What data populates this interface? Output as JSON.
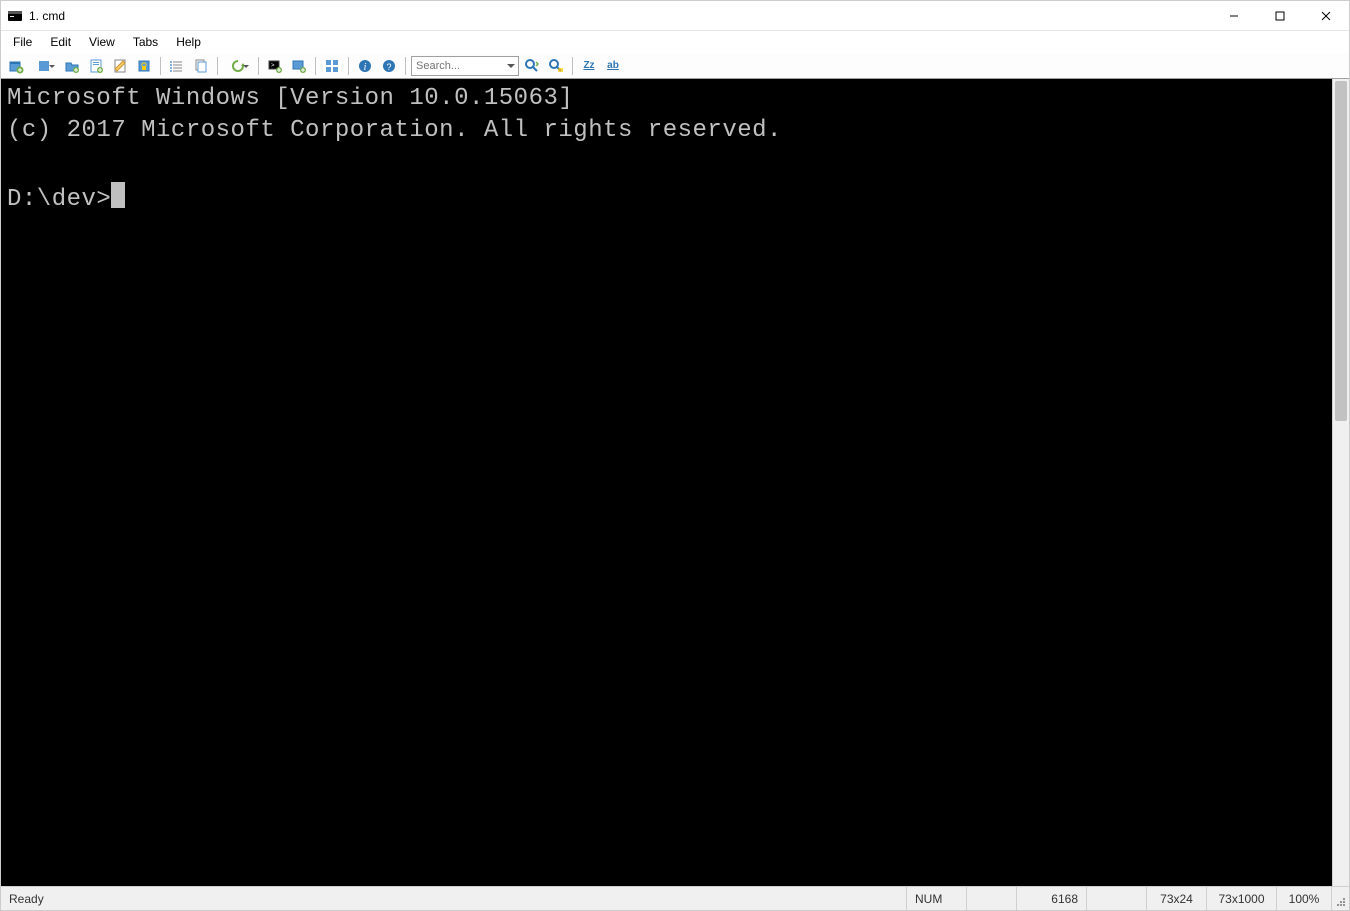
{
  "title": "1. cmd",
  "menu": {
    "items": [
      "File",
      "Edit",
      "View",
      "Tabs",
      "Help"
    ]
  },
  "toolbar": {
    "search_placeholder": "Search...",
    "buttons": [
      {
        "name": "new-tab-icon",
        "label": "New tab"
      },
      {
        "name": "new-tab-drop-icon",
        "label": "New tab options",
        "drop": true
      },
      {
        "name": "open-folder-icon",
        "label": "Open"
      },
      {
        "name": "save-icon",
        "label": "Save"
      },
      {
        "name": "edit-icon",
        "label": "Edit"
      },
      {
        "name": "lock-icon",
        "label": "Lock"
      },
      {
        "sep": true
      },
      {
        "name": "list-icon",
        "label": "List"
      },
      {
        "name": "copy-icon",
        "label": "Copy"
      },
      {
        "sep": true
      },
      {
        "name": "refresh-drop-icon",
        "label": "Refresh options",
        "drop": true
      },
      {
        "sep": true
      },
      {
        "name": "new-console-icon",
        "label": "New console"
      },
      {
        "name": "attach-icon",
        "label": "Attach"
      },
      {
        "sep": true
      },
      {
        "name": "settings-icon",
        "label": "Settings"
      },
      {
        "sep": true
      },
      {
        "name": "info-icon",
        "label": "Info"
      },
      {
        "name": "help-icon",
        "label": "Help"
      },
      {
        "sep": true
      },
      {
        "search": true
      },
      {
        "name": "find-next-icon",
        "label": "Find next"
      },
      {
        "name": "find-highlight-icon",
        "label": "Find highlight"
      },
      {
        "sep": true
      },
      {
        "name": "case-toggle-icon",
        "label": "Case",
        "text": "Zz"
      },
      {
        "name": "word-toggle-icon",
        "label": "Word",
        "text": "ab"
      }
    ]
  },
  "terminal": {
    "lines": [
      "Microsoft Windows [Version 10.0.15063]",
      "(c) 2017 Microsoft Corporation. All rights reserved.",
      "",
      "D:\\dev>"
    ]
  },
  "status": {
    "ready": "Ready",
    "numlock": "NUM",
    "pid": "6168",
    "viewport": "73x24",
    "buffer": "73x1000",
    "zoom": "100%"
  }
}
